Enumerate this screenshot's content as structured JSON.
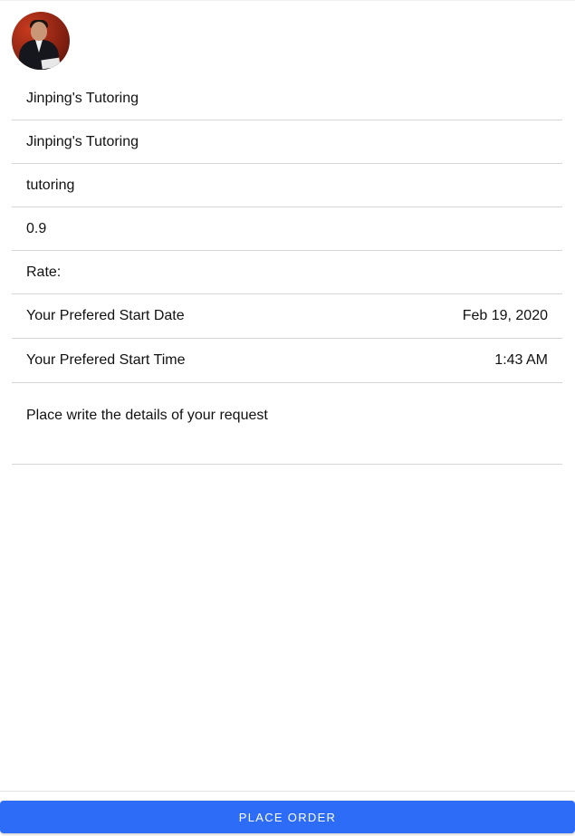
{
  "avatar": {
    "icon": "person-portrait-photo"
  },
  "fields": {
    "business_name": "Jinping's Tutoring",
    "service_name": "Jinping's Tutoring",
    "category": "tutoring",
    "price": "0.9",
    "rate_label": "Rate:"
  },
  "start_date": {
    "label": "Your Prefered Start Date",
    "value": "Feb 19, 2020"
  },
  "start_time": {
    "label": "Your Prefered Start Time",
    "value": "1:43 AM"
  },
  "details": {
    "placeholder": "Place write the details of your request"
  },
  "actions": {
    "place_order_label": "PLACE ORDER"
  },
  "colors": {
    "accent": "#2d6cf6"
  }
}
